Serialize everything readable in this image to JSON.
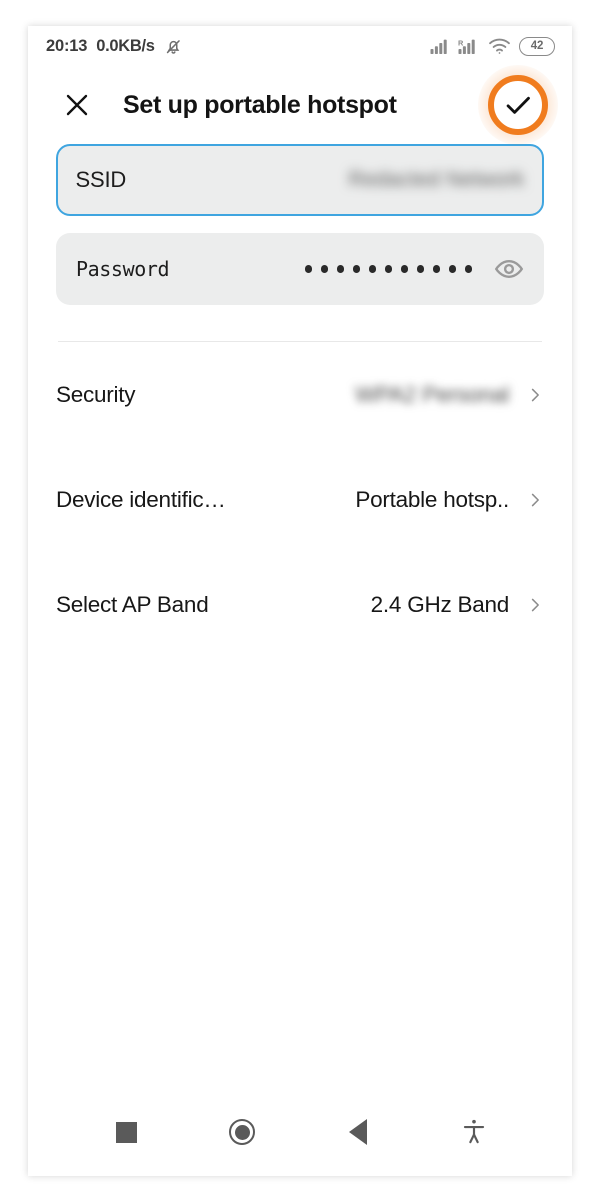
{
  "statusbar": {
    "clock": "20:13",
    "network_speed": "0.0KB/s",
    "notification_icon": "bell-muted-icon",
    "signal_icon": "signal-bars-icon",
    "signal_roaming_icon": "signal-bars-roaming-icon",
    "roaming_label": "R",
    "wifi_icon": "wifi-icon",
    "battery_level": "42"
  },
  "appbar": {
    "close_icon": "close-icon",
    "title": "Set up portable hotspot",
    "confirm_icon": "check-icon"
  },
  "fields": [
    {
      "label": "SSID",
      "value": "Redacted Network",
      "redacted": true,
      "focused": true
    },
    {
      "label": "Password",
      "value": "•••••••••••",
      "dot_count": 11,
      "reveal_icon": "eye-icon",
      "redacted": false,
      "focused": false
    }
  ],
  "rows": [
    {
      "label": "Security",
      "value": "WPA2 Personal",
      "redacted": true,
      "chevron_icon": "chevron-right-icon"
    },
    {
      "label": "Device identific…",
      "value": "Portable hotsp..",
      "redacted": false,
      "chevron_icon": "chevron-right-icon"
    },
    {
      "label": "Select AP Band",
      "value": "2.4 GHz Band",
      "redacted": false,
      "chevron_icon": "chevron-right-icon"
    }
  ],
  "navbar": {
    "recents_icon": "square-recents-icon",
    "home_icon": "circle-home-icon",
    "back_icon": "triangle-back-icon",
    "accessibility_icon": "accessibility-icon"
  },
  "colors": {
    "accent_highlight": "#f07c1e",
    "focus_border": "#3fa5e0",
    "field_background": "#eceded",
    "text_primary": "#171717"
  }
}
